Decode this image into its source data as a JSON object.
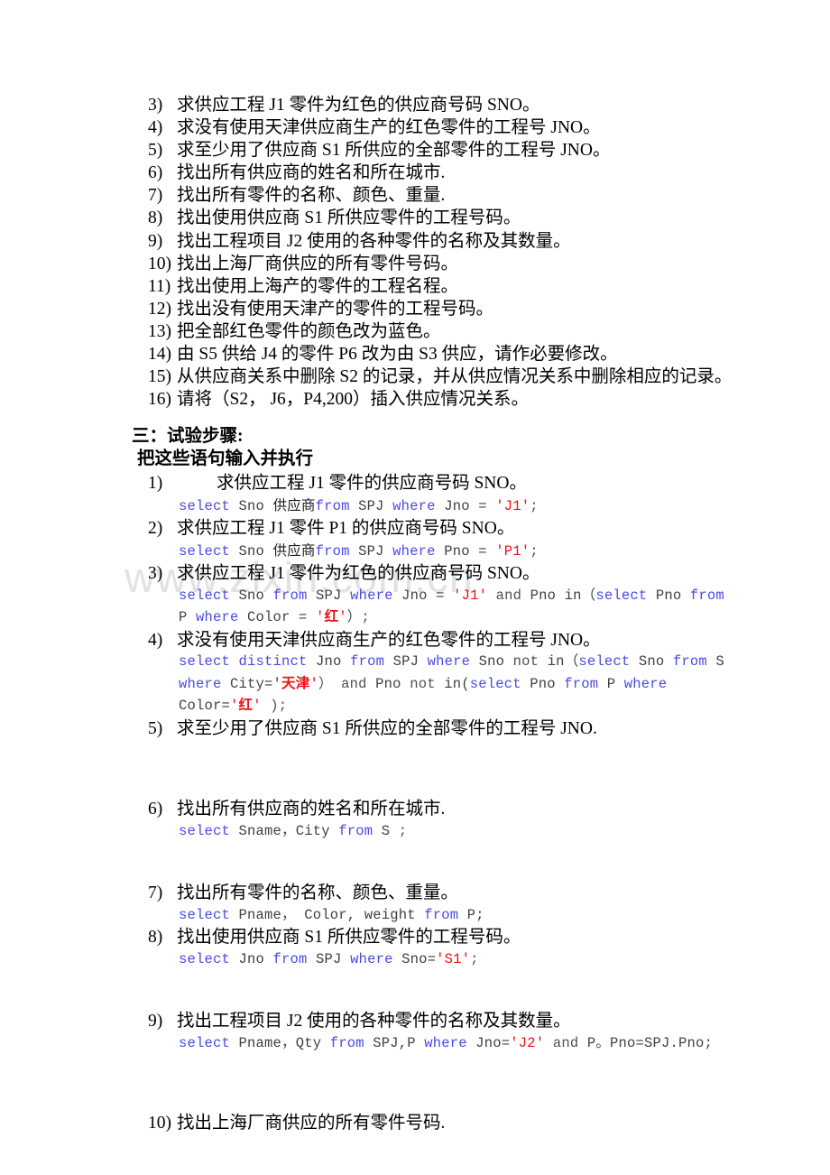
{
  "watermark": {
    "text": "www.zixin.com.cn"
  },
  "questions": [
    {
      "num": "3)",
      "text": "求供应工程 J1 零件为红色的供应商号码 SNO。"
    },
    {
      "num": "4)",
      "text": "求没有使用天津供应商生产的红色零件的工程号 JNO。"
    },
    {
      "num": "5)",
      "text": "求至少用了供应商 S1 所供应的全部零件的工程号 JNO。"
    },
    {
      "num": "6)",
      "text": "找出所有供应商的姓名和所在城市."
    },
    {
      "num": "7)",
      "text": "找出所有零件的名称、颜色、重量."
    },
    {
      "num": "8)",
      "text": "找出使用供应商 S1 所供应零件的工程号码。"
    },
    {
      "num": "9)",
      "text": "找出工程项目 J2 使用的各种零件的名称及其数量。"
    },
    {
      "num": "10)",
      "text": "找出上海厂商供应的所有零件号码。"
    },
    {
      "num": "11)",
      "text": "找出使用上海产的零件的工程名程。"
    },
    {
      "num": "12)",
      "text": "找出没有使用天津产的零件的工程号码。"
    },
    {
      "num": "13)",
      "text": "把全部红色零件的颜色改为蓝色。"
    },
    {
      "num": "14)",
      "text": "由 S5 供给 J4 的零件 P6 改为由 S3 供应，请作必要修改。"
    },
    {
      "num": "15)",
      "text": "从供应商关系中删除 S2 的记录，并从供应情况关系中删除相应的记录。"
    },
    {
      "num": "16)",
      "text": "请将（S2， J6，P4,200）插入供应情况关系。"
    }
  ],
  "headings": {
    "section": "三：试验步骤:",
    "subsection": "把这些语句输入并执行"
  },
  "steps": [
    {
      "num": "1)",
      "text": "求供应工程 J1 零件的供应商号码 SNO。",
      "indented": true,
      "sql": [
        [
          {
            "t": "select",
            "c": "kw"
          },
          {
            "t": " Sno ",
            "c": "id"
          },
          {
            "t": "供应商",
            "c": "cjk"
          },
          {
            "t": "from",
            "c": "kw"
          },
          {
            "t": " SPJ ",
            "c": "id"
          },
          {
            "t": "where",
            "c": "kw"
          },
          {
            "t": " Jno = ",
            "c": "id"
          },
          {
            "t": "′J1′",
            "c": "str"
          },
          {
            "t": ";",
            "c": "pun"
          }
        ]
      ]
    },
    {
      "num": "2)",
      "text": "求供应工程 J1 零件 P1 的供应商号码 SNO。",
      "indented": false,
      "sql": [
        [
          {
            "t": "select",
            "c": "kw"
          },
          {
            "t": " Sno ",
            "c": "id"
          },
          {
            "t": "供应商",
            "c": "cjk"
          },
          {
            "t": "from",
            "c": "kw"
          },
          {
            "t": " SPJ ",
            "c": "id"
          },
          {
            "t": "where",
            "c": "kw"
          },
          {
            "t": " Pno = ",
            "c": "id"
          },
          {
            "t": "'P1'",
            "c": "str"
          },
          {
            "t": ";",
            "c": "pun"
          }
        ]
      ]
    },
    {
      "num": "3)",
      "text": "求供应工程 J1 零件为红色的供应商号码 SNO。",
      "indented": false,
      "sql": [
        [
          {
            "t": "select",
            "c": "kw"
          },
          {
            "t": " Sno ",
            "c": "id"
          },
          {
            "t": "from",
            "c": "kw"
          },
          {
            "t": " SPJ ",
            "c": "id"
          },
          {
            "t": "where",
            "c": "kw"
          },
          {
            "t": " Jno = ",
            "c": "id"
          },
          {
            "t": "′J1′",
            "c": "str"
          },
          {
            "t": " and ",
            "c": "pun"
          },
          {
            "t": "Pno in（",
            "c": "id"
          },
          {
            "t": "select",
            "c": "kw"
          },
          {
            "t": " Pno ",
            "c": "id"
          },
          {
            "t": "from",
            "c": "kw"
          }
        ],
        [
          {
            "t": "P ",
            "c": "id"
          },
          {
            "t": "where",
            "c": "kw"
          },
          {
            "t": " Color = ",
            "c": "id"
          },
          {
            "t": "′",
            "c": "str"
          },
          {
            "t": "红",
            "c": "cjkred"
          },
          {
            "t": "′",
            "c": "str"
          },
          {
            "t": "）;",
            "c": "pun"
          }
        ]
      ]
    },
    {
      "num": "4)",
      "text": "求没有使用天津供应商生产的红色零件的工程号 JNO。",
      "indented": false,
      "sql": [
        [
          {
            "t": "select",
            "c": "kw"
          },
          {
            "t": " ",
            "c": "id"
          },
          {
            "t": "distinct",
            "c": "kw"
          },
          {
            "t": " Jno ",
            "c": "id"
          },
          {
            "t": "from",
            "c": "kw"
          },
          {
            "t": " SPJ ",
            "c": "id"
          },
          {
            "t": "where",
            "c": "kw"
          },
          {
            "t": " Sno ",
            "c": "id"
          },
          {
            "t": "not",
            "c": "pun"
          },
          {
            "t": " in（",
            "c": "id"
          },
          {
            "t": "select",
            "c": "kw"
          },
          {
            "t": " Sno ",
            "c": "id"
          },
          {
            "t": "from",
            "c": "kw"
          },
          {
            "t": " S",
            "c": "id"
          }
        ],
        [
          {
            "t": "where",
            "c": "kw"
          },
          {
            "t": " City='",
            "c": "id"
          },
          {
            "t": "天津",
            "c": "cjkred"
          },
          {
            "t": "′",
            "c": "str"
          },
          {
            "t": "）",
            "c": "pun"
          },
          {
            "t": " and ",
            "c": "pun"
          },
          {
            "t": "Pno ",
            "c": "id"
          },
          {
            "t": "not",
            "c": "pun"
          },
          {
            "t": " in(",
            "c": "id"
          },
          {
            "t": "select",
            "c": "kw"
          },
          {
            "t": " Pno ",
            "c": "id"
          },
          {
            "t": "from",
            "c": "kw"
          },
          {
            "t": " P ",
            "c": "id"
          },
          {
            "t": "where",
            "c": "kw"
          }
        ],
        [
          {
            "t": "Color=",
            "c": "id"
          },
          {
            "t": "′",
            "c": "str"
          },
          {
            "t": "红",
            "c": "cjkred"
          },
          {
            "t": "'",
            "c": "str"
          },
          {
            "t": " );",
            "c": "pun"
          }
        ]
      ]
    },
    {
      "num": "5)",
      "text": "求至少用了供应商 S1 所供应的全部零件的工程号 JNO.",
      "indented": false,
      "sql": []
    },
    {
      "num": "6)",
      "text": "找出所有供应商的姓名和所在城市.",
      "indented": false,
      "sql": [
        [
          {
            "t": "select",
            "c": "kw"
          },
          {
            "t": " Sname，City ",
            "c": "id"
          },
          {
            "t": "from",
            "c": "kw"
          },
          {
            "t": " S ",
            "c": "id"
          },
          {
            "t": ";",
            "c": "pun"
          }
        ]
      ]
    },
    {
      "num": "7)",
      "text": "找出所有零件的名称、颜色、重量。",
      "indented": false,
      "sql": [
        [
          {
            "t": "select",
            "c": "kw"
          },
          {
            "t": " Pname， Color, weight ",
            "c": "id"
          },
          {
            "t": "from",
            "c": "kw"
          },
          {
            "t": " P;",
            "c": "id"
          }
        ]
      ]
    },
    {
      "num": "8)",
      "text": "找出使用供应商 S1 所供应零件的工程号码。",
      "indented": false,
      "sql": [
        [
          {
            "t": "select",
            "c": "kw"
          },
          {
            "t": " Jno ",
            "c": "id"
          },
          {
            "t": "from",
            "c": "kw"
          },
          {
            "t": " SPJ ",
            "c": "id"
          },
          {
            "t": "where",
            "c": "kw"
          },
          {
            "t": " Sno=",
            "c": "id"
          },
          {
            "t": "′S1'",
            "c": "str"
          },
          {
            "t": ";",
            "c": "pun"
          }
        ]
      ]
    },
    {
      "num": "9)",
      "text": "找出工程项目 J2 使用的各种零件的名称及其数量。",
      "indented": false,
      "sql": [
        [
          {
            "t": "select",
            "c": "kw"
          },
          {
            "t": " Pname，Qty ",
            "c": "id"
          },
          {
            "t": "from",
            "c": "kw"
          },
          {
            "t": " SPJ,P ",
            "c": "id"
          },
          {
            "t": "where",
            "c": "kw"
          },
          {
            "t": " Jno=",
            "c": "id"
          },
          {
            "t": "'J2'",
            "c": "str"
          },
          {
            "t": " and ",
            "c": "pun"
          },
          {
            "t": "P。Pno=SPJ.Pno;",
            "c": "id"
          }
        ]
      ]
    },
    {
      "num": "10)",
      "text": "找出上海厂商供应的所有零件号码.",
      "indented": false,
      "sql": []
    }
  ]
}
